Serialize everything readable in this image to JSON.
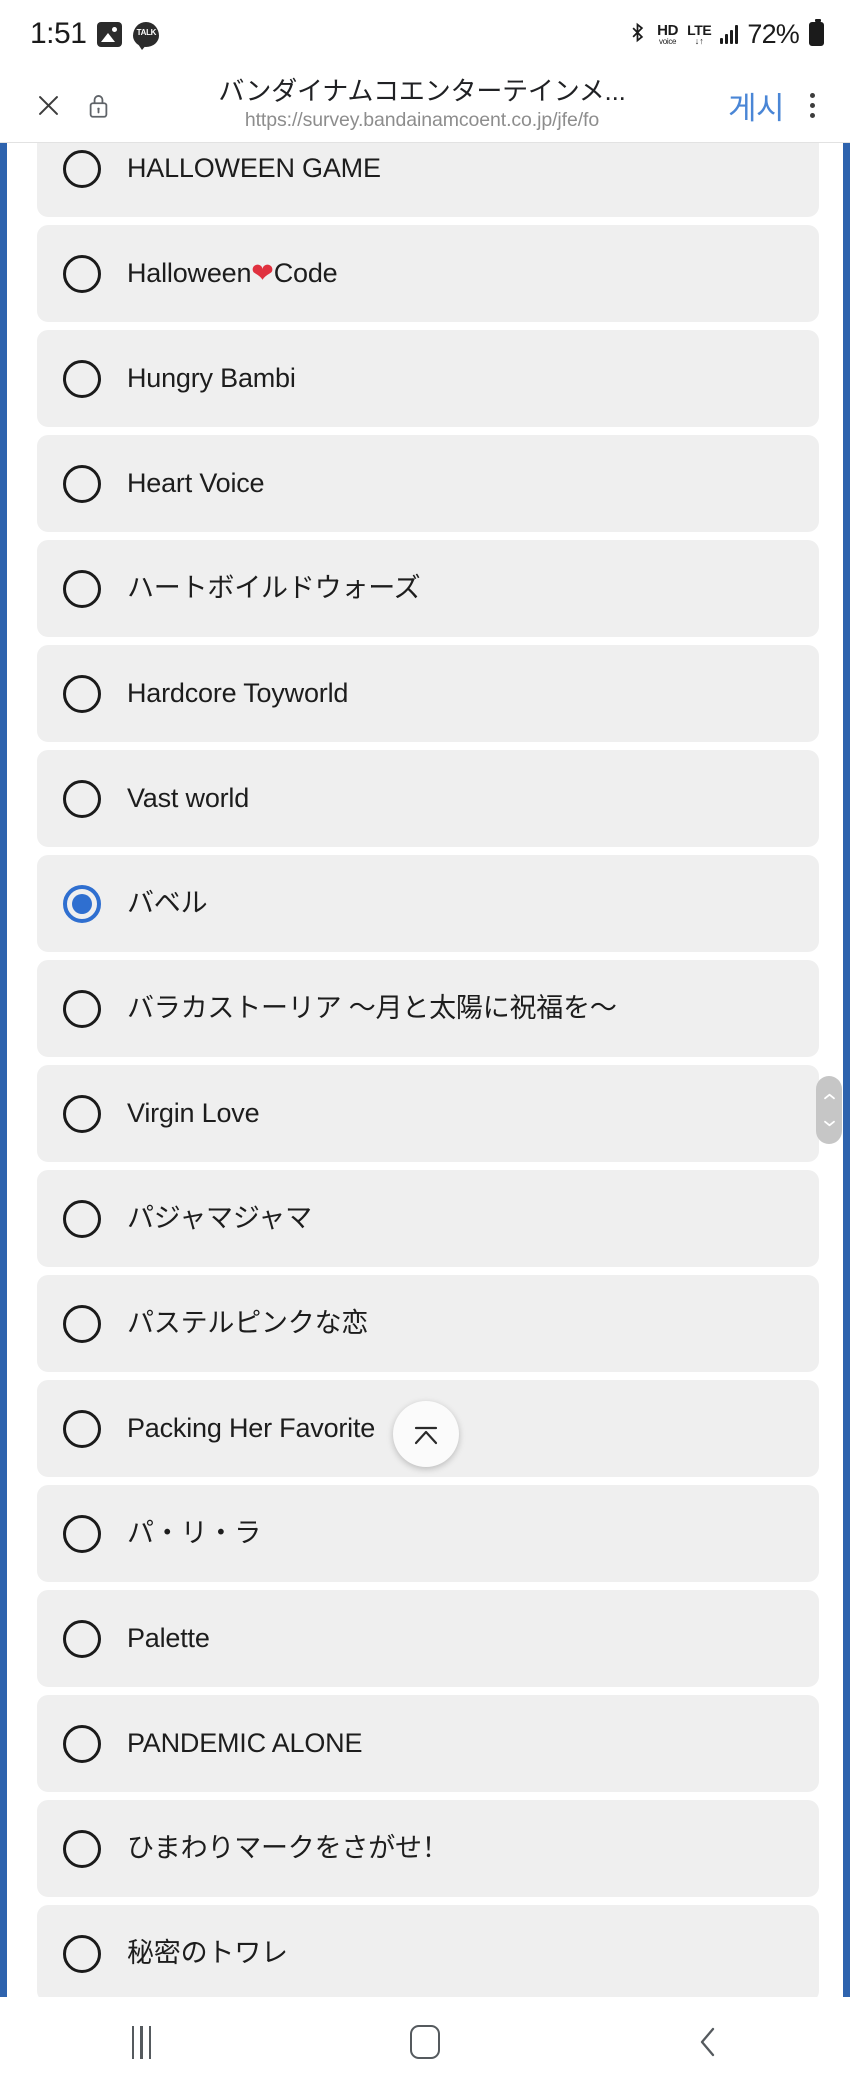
{
  "status_bar": {
    "clock": "1:51",
    "icons": [
      "photo-icon",
      "kakaotalk-icon"
    ],
    "talk_label": "TALK",
    "bluetooth_glyph": "ᛦ",
    "hd_top": "HD",
    "hd_bottom": "voice",
    "lte_top": "LTE",
    "lte_bottom": "↓↑",
    "battery_percent": "72%"
  },
  "browser_bar": {
    "close_label": "close-icon",
    "lock_label": "lock-icon",
    "title": "バンダイナムコエンターテインメ...",
    "url": "https://survey.bandainamcoent.co.jp/jfe/fo",
    "action_label": "게시",
    "action_color": "#4a86d6",
    "menu_label": "more-options"
  },
  "form": {
    "accent_color": "#2f6fd0",
    "row_background": "#efefef",
    "selected_index": 7,
    "options": [
      {
        "label": "HALLOWEEN GAME",
        "selected": false
      },
      {
        "label": "Halloween❤Code",
        "selected": false,
        "has_heart": true,
        "pre": "Halloween",
        "post": "Code"
      },
      {
        "label": "Hungry Bambi",
        "selected": false
      },
      {
        "label": "Heart Voice",
        "selected": false
      },
      {
        "label": "ハートボイルドウォーズ",
        "selected": false
      },
      {
        "label": "Hardcore Toyworld",
        "selected": false
      },
      {
        "label": "Vast world",
        "selected": false
      },
      {
        "label": "バベル",
        "selected": true
      },
      {
        "label": "バラカストーリア ～月と太陽に祝福を～",
        "selected": false
      },
      {
        "label": "Virgin Love",
        "selected": false
      },
      {
        "label": "パジャマジャマ",
        "selected": false
      },
      {
        "label": "パステルピンクな恋",
        "selected": false
      },
      {
        "label": "Packing Her Favorite",
        "selected": false
      },
      {
        "label": "パ・リ・ラ",
        "selected": false
      },
      {
        "label": "Palette",
        "selected": false
      },
      {
        "label": "PANDEMIC ALONE",
        "selected": false
      },
      {
        "label": "ひまわりマークをさがせ！",
        "selected": false
      },
      {
        "label": "秘密のトワレ",
        "selected": false
      }
    ]
  },
  "overlays": {
    "scroll_thumb_label": "scrollbar-thumb",
    "fab_label": "scroll-to-top-button"
  },
  "nav_bar": {
    "recents_label": "recent-apps-button",
    "home_label": "home-button",
    "back_label": "back-button"
  }
}
